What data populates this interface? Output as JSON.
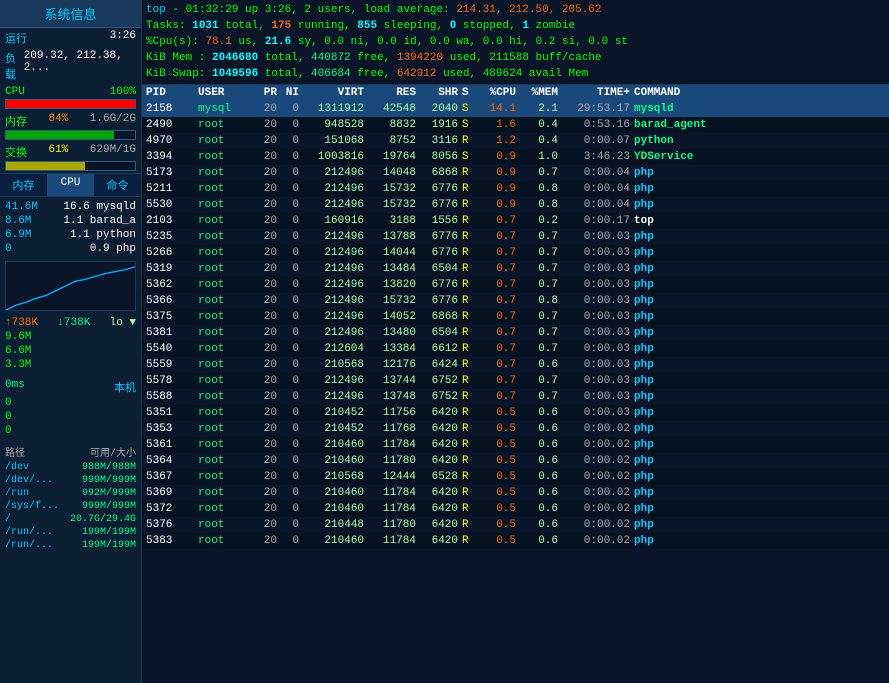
{
  "sidebar": {
    "title": "系统信息",
    "running": {
      "label": "运行",
      "value": "3:26"
    },
    "load": {
      "label": "负载",
      "value": "209.32, 212.38, 2..."
    },
    "cpu": {
      "label": "CPU",
      "percent": 100,
      "display": "100%"
    },
    "mem": {
      "label": "内存",
      "percent": 84,
      "display": "84%",
      "detail": "1.6G/2G"
    },
    "swap": {
      "label": "交换",
      "percent": 61,
      "display": "61%",
      "detail": "629M/1G"
    },
    "tabs": [
      "内存",
      "CPU",
      "命令"
    ],
    "active_tab": "CPU",
    "cpu_processes": [
      {
        "name": "41.6M",
        "val": "16.6 mysqld"
      },
      {
        "name": "8.6M",
        "val": "1.1 barad_a"
      },
      {
        "name": "6.9M",
        "val": "1.1 python"
      },
      {
        "name": "0",
        "val": "0.9 php"
      }
    ],
    "net": {
      "up_arrow": "↑738K",
      "down_arrow": "↓738K",
      "lo": "lo ▼",
      "values": [
        "9.6M",
        "6.6M",
        "3.3M"
      ]
    },
    "latency": {
      "label": "0ms",
      "host": "本机",
      "values": [
        "0",
        "0",
        "0"
      ]
    },
    "disk_header": {
      "label": "路径",
      "size": "可用/大小"
    },
    "disks": [
      {
        "path": "/dev",
        "size": "988M/988M"
      },
      {
        "path": "/dev/...",
        "size": "999M/999M"
      },
      {
        "path": "/run",
        "size": "992M/999M"
      },
      {
        "path": "/sys/f...",
        "size": "999M/999M"
      },
      {
        "path": "/",
        "size": "20.7G/29.4G"
      },
      {
        "path": "/run/...",
        "size": "199M/199M"
      },
      {
        "path": "/run/...",
        "size": "199M/199M"
      }
    ]
  },
  "header": {
    "line1": "top - 01:32:29 up  3:26,  2 users,  load average: 214.31, 212.50, 205.62",
    "line2": "Tasks: 1031 total,  175 running, 855 sleeping,   0 stopped,   1 zombie",
    "line3": "%Cpu(s): 78.1 us, 21.6 sy,  0.0 ni,  0.0 id,  0.0 wa,  0.0 hi,  0.2 si,  0.0 st",
    "line4": "KiB Mem :  2046680 total,   440872 free,  1394220 used,   211588 buff/cache",
    "line5": "KiB Swap:  1049596 total,   406684 free,   642912 used,   489624 avail Mem"
  },
  "table": {
    "columns": [
      "PID",
      "USER",
      "PR",
      "NI",
      "VIRT",
      "RES",
      "SHR",
      "S",
      "%CPU",
      "%MEM",
      "TIME+",
      "COMMAND"
    ],
    "rows": [
      {
        "pid": "2158",
        "user": "mysql",
        "pr": "20",
        "ni": "0",
        "virt": "1311912",
        "res": "42548",
        "shr": "2040",
        "s": "S",
        "cpu": "14.1",
        "mem": "2.1",
        "time": "29:53.17",
        "cmd": "mysqld",
        "highlighted": true
      },
      {
        "pid": "2490",
        "user": "root",
        "pr": "20",
        "ni": "0",
        "virt": "948528",
        "res": "8832",
        "shr": "1916",
        "s": "S",
        "cpu": "1.6",
        "mem": "0.4",
        "time": "0:53.16",
        "cmd": "barad_agent"
      },
      {
        "pid": "4970",
        "user": "root",
        "pr": "20",
        "ni": "0",
        "virt": "151068",
        "res": "8752",
        "shr": "3116",
        "s": "R",
        "cpu": "1.2",
        "mem": "0.4",
        "time": "0:00.07",
        "cmd": "python"
      },
      {
        "pid": "3394",
        "user": "root",
        "pr": "20",
        "ni": "0",
        "virt": "1003816",
        "res": "19764",
        "shr": "8056",
        "s": "S",
        "cpu": "0.9",
        "mem": "1.0",
        "time": "3:46.23",
        "cmd": "YDService"
      },
      {
        "pid": "5173",
        "user": "root",
        "pr": "20",
        "ni": "0",
        "virt": "212496",
        "res": "14048",
        "shr": "6868",
        "s": "R",
        "cpu": "0.9",
        "mem": "0.7",
        "time": "0:00.04",
        "cmd": "php"
      },
      {
        "pid": "5211",
        "user": "root",
        "pr": "20",
        "ni": "0",
        "virt": "212496",
        "res": "15732",
        "shr": "6776",
        "s": "R",
        "cpu": "0.9",
        "mem": "0.8",
        "time": "0:00.04",
        "cmd": "php"
      },
      {
        "pid": "5530",
        "user": "root",
        "pr": "20",
        "ni": "0",
        "virt": "212496",
        "res": "15732",
        "shr": "6776",
        "s": "R",
        "cpu": "0.9",
        "mem": "0.8",
        "time": "0:00.04",
        "cmd": "php"
      },
      {
        "pid": "2103",
        "user": "root",
        "pr": "20",
        "ni": "0",
        "virt": "160916",
        "res": "3188",
        "shr": "1556",
        "s": "R",
        "cpu": "0.7",
        "mem": "0.2",
        "time": "0:00.17",
        "cmd": "top"
      },
      {
        "pid": "5235",
        "user": "root",
        "pr": "20",
        "ni": "0",
        "virt": "212496",
        "res": "13788",
        "shr": "6776",
        "s": "R",
        "cpu": "0.7",
        "mem": "0.7",
        "time": "0:00.03",
        "cmd": "php"
      },
      {
        "pid": "5266",
        "user": "root",
        "pr": "20",
        "ni": "0",
        "virt": "212496",
        "res": "14044",
        "shr": "6776",
        "s": "R",
        "cpu": "0.7",
        "mem": "0.7",
        "time": "0:00.03",
        "cmd": "php"
      },
      {
        "pid": "5319",
        "user": "root",
        "pr": "20",
        "ni": "0",
        "virt": "212496",
        "res": "13484",
        "shr": "6504",
        "s": "R",
        "cpu": "0.7",
        "mem": "0.7",
        "time": "0:00.03",
        "cmd": "php"
      },
      {
        "pid": "5362",
        "user": "root",
        "pr": "20",
        "ni": "0",
        "virt": "212496",
        "res": "13820",
        "shr": "6776",
        "s": "R",
        "cpu": "0.7",
        "mem": "0.7",
        "time": "0:00.03",
        "cmd": "php"
      },
      {
        "pid": "5366",
        "user": "root",
        "pr": "20",
        "ni": "0",
        "virt": "212496",
        "res": "15732",
        "shr": "6776",
        "s": "R",
        "cpu": "0.7",
        "mem": "0.8",
        "time": "0:00.03",
        "cmd": "php"
      },
      {
        "pid": "5375",
        "user": "root",
        "pr": "20",
        "ni": "0",
        "virt": "212496",
        "res": "14052",
        "shr": "6868",
        "s": "R",
        "cpu": "0.7",
        "mem": "0.7",
        "time": "0:00.03",
        "cmd": "php"
      },
      {
        "pid": "5381",
        "user": "root",
        "pr": "20",
        "ni": "0",
        "virt": "212496",
        "res": "13480",
        "shr": "6504",
        "s": "R",
        "cpu": "0.7",
        "mem": "0.7",
        "time": "0:00.03",
        "cmd": "php"
      },
      {
        "pid": "5540",
        "user": "root",
        "pr": "20",
        "ni": "0",
        "virt": "212604",
        "res": "13384",
        "shr": "6612",
        "s": "R",
        "cpu": "0.7",
        "mem": "0.7",
        "time": "0:00.03",
        "cmd": "php"
      },
      {
        "pid": "5559",
        "user": "root",
        "pr": "20",
        "ni": "0",
        "virt": "210568",
        "res": "12176",
        "shr": "6424",
        "s": "R",
        "cpu": "0.7",
        "mem": "0.6",
        "time": "0:00.03",
        "cmd": "php"
      },
      {
        "pid": "5578",
        "user": "root",
        "pr": "20",
        "ni": "0",
        "virt": "212496",
        "res": "13744",
        "shr": "6752",
        "s": "R",
        "cpu": "0.7",
        "mem": "0.7",
        "time": "0:00.03",
        "cmd": "php"
      },
      {
        "pid": "5588",
        "user": "root",
        "pr": "20",
        "ni": "0",
        "virt": "212496",
        "res": "13748",
        "shr": "6752",
        "s": "R",
        "cpu": "0.7",
        "mem": "0.7",
        "time": "0:00.03",
        "cmd": "php"
      },
      {
        "pid": "5351",
        "user": "root",
        "pr": "20",
        "ni": "0",
        "virt": "210452",
        "res": "11756",
        "shr": "6420",
        "s": "R",
        "cpu": "0.5",
        "mem": "0.6",
        "time": "0:00.03",
        "cmd": "php"
      },
      {
        "pid": "5353",
        "user": "root",
        "pr": "20",
        "ni": "0",
        "virt": "210452",
        "res": "11768",
        "shr": "6420",
        "s": "R",
        "cpu": "0.5",
        "mem": "0.6",
        "time": "0:00.02",
        "cmd": "php"
      },
      {
        "pid": "5361",
        "user": "root",
        "pr": "20",
        "ni": "0",
        "virt": "210460",
        "res": "11784",
        "shr": "6420",
        "s": "R",
        "cpu": "0.5",
        "mem": "0.6",
        "time": "0:00.02",
        "cmd": "php"
      },
      {
        "pid": "5364",
        "user": "root",
        "pr": "20",
        "ni": "0",
        "virt": "210460",
        "res": "11780",
        "shr": "6420",
        "s": "R",
        "cpu": "0.5",
        "mem": "0.6",
        "time": "0:00.02",
        "cmd": "php"
      },
      {
        "pid": "5367",
        "user": "root",
        "pr": "20",
        "ni": "0",
        "virt": "210568",
        "res": "12444",
        "shr": "6528",
        "s": "R",
        "cpu": "0.5",
        "mem": "0.6",
        "time": "0:00.02",
        "cmd": "php"
      },
      {
        "pid": "5369",
        "user": "root",
        "pr": "20",
        "ni": "0",
        "virt": "210460",
        "res": "11784",
        "shr": "6420",
        "s": "R",
        "cpu": "0.5",
        "mem": "0.6",
        "time": "0:00.02",
        "cmd": "php"
      },
      {
        "pid": "5372",
        "user": "root",
        "pr": "20",
        "ni": "0",
        "virt": "210460",
        "res": "11784",
        "shr": "6420",
        "s": "R",
        "cpu": "0.5",
        "mem": "0.6",
        "time": "0:00.02",
        "cmd": "php"
      },
      {
        "pid": "5376",
        "user": "root",
        "pr": "20",
        "ni": "0",
        "virt": "210448",
        "res": "11780",
        "shr": "6420",
        "s": "R",
        "cpu": "0.5",
        "mem": "0.6",
        "time": "0:00.02",
        "cmd": "php"
      },
      {
        "pid": "5383",
        "user": "root",
        "pr": "20",
        "ni": "0",
        "virt": "210460",
        "res": "11784",
        "shr": "6420",
        "s": "R",
        "cpu": "0.5",
        "mem": "0.6",
        "time": "0:00.02",
        "cmd": "php"
      }
    ]
  }
}
